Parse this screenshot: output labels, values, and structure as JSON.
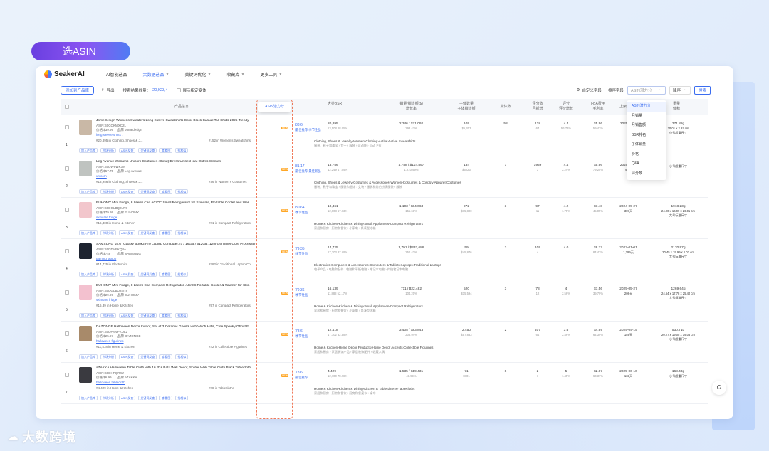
{
  "badge": "选ASIN",
  "nav": {
    "logo": "SeakerAI",
    "items": [
      {
        "label": "AI智能选品",
        "active": false,
        "caret": false
      },
      {
        "label": "大数据选品",
        "active": true,
        "caret": true
      },
      {
        "label": "关键词优化",
        "active": false,
        "caret": true
      },
      {
        "label": "收藏库",
        "active": false,
        "caret": true
      },
      {
        "label": "更多工具",
        "active": false,
        "caret": true
      }
    ]
  },
  "toolbar": {
    "add_button": "添加到产品库",
    "export": "导出",
    "result_prefix": "搜索结果数量：",
    "result_count": "20,923,4",
    "show_variants": "展示指定变体",
    "custom_columns": "自定义字段",
    "sort_label": "排序字段",
    "sort_value": "ASIN潜力分",
    "order_value": "降序",
    "search_btn": "搜索"
  },
  "sort_dropdown": [
    "ASIN潜力分",
    "月销量",
    "月销售额",
    "BSR排名",
    "子体销量",
    "价格",
    "Q&A",
    "评分数"
  ],
  "asin_tab": "ASIN潜力分",
  "table_head": {
    "product": "产品信息",
    "asin_score": "ASIN潜力分",
    "bsr": "大类BSR",
    "sales": "销量/销售额($)\n增长率",
    "child": "子体数量\n子体销售额",
    "variants": "变体数",
    "reviews": "评分数\n月新增",
    "ratings": "评分\n评价增长",
    "fba": "FBA费用\n毛利率",
    "launch": "上架时间",
    "weight": "重量\n体积"
  },
  "rows": [
    {
      "num": "1",
      "title": "JomeDesign Womens Sweaters Long Sleeve Sweatshirts Color Block Casual Tall Shirts 2025 Trendy",
      "asin": "ASIN:B0CQKMXC2L",
      "price": "价格 $39.99",
      "brand_line": "品牌 Jomedesign",
      "link": "long sleeve shirts t",
      "rank": "#20,895 in Clothing, Shoes & J...",
      "rank2": "#152 in Women's Sweatshirts",
      "score": "88.6",
      "score_sub": "最佳推荐  季节性品",
      "cat": "Clothing, Shoes & Jewelry›Women›Clothing›Active›Active Sweatshirts",
      "cat2": "服装、鞋子和珠宝 › 女士 › 服装 › 运动装 › 运动卫衣",
      "bsr": "20,895",
      "bsr_sub": "13,508  68.05%",
      "sales": "2,346 / $71,092",
      "sales_sub": "293.47%",
      "child": "109",
      "child_sub": "$5,303",
      "variants": "58",
      "reviews": "128",
      "reviews_sub": "64",
      "rating": "4.4",
      "rating_sub": "56.72%",
      "fba": "$5.96",
      "fba_sub": "59.47%",
      "launch": "2025-01-...",
      "launch_sub": "",
      "weight": "371.88g",
      "weight_sub": "20.01 x 2.92 cm",
      "weight_sub2": "小号超重尺寸",
      "thumb": "#c9b8a6"
    },
    {
      "num": "2",
      "title": "Leg Avenue Womens Unicorn Costumes (Oimd) Dress UnisexHeat Outfits Women",
      "asin": "ASIN:B0DW8WK3M",
      "price": "价格 $57.75",
      "brand_line": "品牌 Leg Avenue",
      "link": "unicorn",
      "rank": "#13,956 in Clothing, Shoes & J...",
      "rank2": "#36 in Women's Costumes",
      "score": "81.17",
      "score_sub": "最佳推荐  最佳新品",
      "cat": "Clothing, Shoes & Jewelry›Costumes & Accessories›Women›Costumes & Cosplay Apparel›Costumes",
      "cat2": "服装、鞋子和珠宝 › 服装和配饰 › 女装 › 服装和角色扮演服装 › 服装",
      "bsr": "13,756",
      "bsr_sub": "12,249  47.09%",
      "sales": "4,788 / $114,897",
      "sales_sub": "1,210.99%",
      "child": "134",
      "child_sub": "$5223",
      "variants": "7",
      "reviews": "1959",
      "reviews_sub": "3",
      "rating": "4.4",
      "rating_sub": "2.24%",
      "fba": "$5.96",
      "fba_sub": "79.25%",
      "launch": "2025-07-...",
      "launch_sub": "95天",
      "weight": "",
      "weight_sub": "",
      "weight_sub2": "小号超重尺寸",
      "thumb": "#bfc3c0"
    },
    {
      "num": "3",
      "title": "EUHOMY Mini Fridge, 8 Liter/6 Can AC/DC Small Refrigerator for Skincare, Portable Cooler and War",
      "asin": "ASIN:B0DGLBQ2NT8",
      "price": "价格 $79.99",
      "brand_line": "品牌 EUHOMY",
      "link": "skincare fridge",
      "rank": "#16,400 in Home & Kitchen",
      "rank2": "#21 in Compact Refrigerators",
      "score": "80.64",
      "score_sub": "季节性品",
      "cat": "Home & Kitchen›Kitchen & Dining›Small Appliances›Compact Refrigerators",
      "cat2": "家居和厨房 › 厨房和餐饮 › 小家电 › 紧凑型冰箱",
      "bsr": "10,461",
      "bsr_sub": "12,008  57.93%",
      "sales": "1,103 / $84,063",
      "sales_sub": "155.61%",
      "child": "972",
      "child_sub": "$75,800",
      "variants": "3",
      "reviews": "97",
      "reviews_sub": "11",
      "rating": "4.2",
      "rating_sub": "1.75%",
      "fba": "$7.48",
      "fba_sub": "45.05%",
      "launch": "2024-09-27",
      "launch_sub": "387天",
      "weight": "1918.23g",
      "weight_sub": "24.00 x 16.99 x 26.01 cm",
      "weight_sub2": "大号标准尺寸",
      "thumb": "#f2c6cc"
    },
    {
      "num": "4",
      "title": "SAMSUNG 15.6\" Galaxy Book2 Pro Laptop Computer, i7 / 16GB / 512GB, 12th Gen Intel Core Processor",
      "asin": "ASIN:B0DTMPKQ4A",
      "price": "价格 $749",
      "brand_line": "品牌 SAMSUNG",
      "link": "gaming laptop",
      "rank": "#14,725 in Electronics",
      "rank2": "#282 in Traditional Laptop Co...",
      "score": "79.35",
      "score_sub": "季节性品",
      "cat": "Electronics›Computers & Accessories›Computers & Tablets›Laptops›Traditional Laptops",
      "cat2": "电子产品 › 电脑和配件 › 电脑和平板电脑 › 笔记本电脑 › 传统笔记本电脑",
      "bsr": "14,725",
      "bsr_sub": "17,203  87.69%",
      "sales": "3,791 / $332,688",
      "sales_sub": "250.42%",
      "child": "59",
      "child_sub": "$45,876",
      "variants": "3",
      "reviews": "109",
      "reviews_sub": "4",
      "rating": "4.0",
      "rating_sub": "",
      "fba": "$8.77",
      "fba_sub": "84.47%",
      "launch": "2022-01-01",
      "launch_sub": "1,299天",
      "weight": "2170.97g",
      "weight_sub": "20.45 x 19.99 x 1.02 cm",
      "weight_sub2": "大号标准尺寸",
      "thumb": "#1e2430"
    },
    {
      "num": "5",
      "title": "EUHOMY Mini Fridge, 8 Liter/6 Can Compact Refrigerator, AC/DC Portable Cooler & Warmer for Skin",
      "asin": "ASIN:B0DGLBQ2NT8",
      "price": "价格 $29.99",
      "brand_line": "品牌 EUHOMY",
      "link": "skincare fridge",
      "rank": "#16,39 in Home & Kitchen",
      "rank2": "#87 in Compact Refrigerators",
      "score": "79.36",
      "score_sub": "季节性品",
      "cat": "Home & Kitchen›Kitchen & Dining›Small Appliances›Compact Refrigerators",
      "cat2": "家居和厨房 › 厨房和餐饮 › 小家电 › 紧凑型冰箱",
      "bsr": "16,139",
      "bsr_sub": "11,888  52.17%",
      "sales": "711 / $22,482",
      "sales_sub": "104.20%",
      "child": "520",
      "child_sub": "$15,594",
      "variants": "3",
      "reviews": "78",
      "reviews_sub": "12",
      "rating": "4",
      "rating_sub": "2.56%",
      "fba": "$7.56",
      "fba_sub": "39.79%",
      "launch": "2025-05-27",
      "launch_sub": "208天",
      "weight": "1269.64g",
      "weight_sub": "24.64 x 17.78 x 25.40 cm",
      "weight_sub2": "大号标准尺寸",
      "thumb": "#f3c1cf"
    },
    {
      "num": "6",
      "title": "DAZONGE Halloween Decor Indoor, Set of 3 Ceramic Ghosts with Witch Hats, Cute Spooky Ghost Fi...",
      "asin": "ASIN:B0DPNVPKDL2",
      "price": "价格 $25.97",
      "brand_line": "品牌 DAZONGE",
      "link": "halloween figurines",
      "rank": "#11,418 in Home & Kitchen",
      "rank2": "#22 in Collectible Figurines",
      "score": "78.6",
      "score_sub": "季节性品",
      "cat": "Home & Kitchen›Home Décor Products›Home Décor Accents›Collectible Figurines",
      "cat2": "家居和厨房 › 家居装饰产品 › 家居装饰配件 › 收藏人偶",
      "bsr": "12,418",
      "bsr_sub": "17,102  32.38%",
      "sales": "3,405 / $83,843",
      "sales_sub": "208.94%",
      "child": "2,450",
      "child_sub": "$57,833",
      "variants": "2",
      "reviews": "407",
      "reviews_sub": "64",
      "rating": "3.6",
      "rating_sub": "2.46%",
      "fba": "$4.99",
      "fba_sub": "64.39%",
      "launch": "2025-04-15",
      "launch_sub": "189天",
      "weight": "530.71g",
      "weight_sub": "20.27 x 19.05 x 19.05 cm",
      "weight_sub2": "小号超重尺寸",
      "thumb": "#a88a6a"
    },
    {
      "num": "7",
      "title": "aZAKKA Halloween Table Cloth with 16 Pcs Bats Wall Decor, Spider Web Table Cloth Black Tablecloth",
      "asin": "ASIN:B0DHPQRIW",
      "price": "价格 $6.99",
      "brand_line": "品牌 aZAKKA",
      "link": "halloween tablecloth",
      "rank": "#4,429 in Home & Kitchen",
      "rank2": "#28 in Tablecloths",
      "score": "78.6",
      "score_sub": "最佳推荐",
      "cat": "Home & Kitchen›Kitchen & Dining›Kitchen & Table Linens›Tablecloths",
      "cat2": "家居和厨房 › 厨房和餐饮 › 厨房和餐桌布 › 桌布",
      "bsr": "4,429",
      "bsr_sub": "12,700  78.28%",
      "sales": "1,535 / $19,431",
      "sales_sub": "41.99%",
      "child": "71",
      "child_sub": "$701",
      "variants": "8",
      "reviews": "2",
      "reviews_sub": "1",
      "rating": "5",
      "rating_sub": "1.45%",
      "fba": "$2.87",
      "fba_sub": "63.37%",
      "launch": "2025-06-10",
      "launch_sub": "133天",
      "weight": "168.43g",
      "weight_sub": "",
      "weight_sub2": "小号超重尺寸",
      "thumb": "#3a3a40"
    }
  ],
  "tag_buttons": [
    "加入产品库",
    "市场分析",
    "ASIN反查",
    "关键词反查",
    "查看图",
    "找相似"
  ],
  "brand_bottom": "大数跨境",
  "support_icon": "headset-icon"
}
